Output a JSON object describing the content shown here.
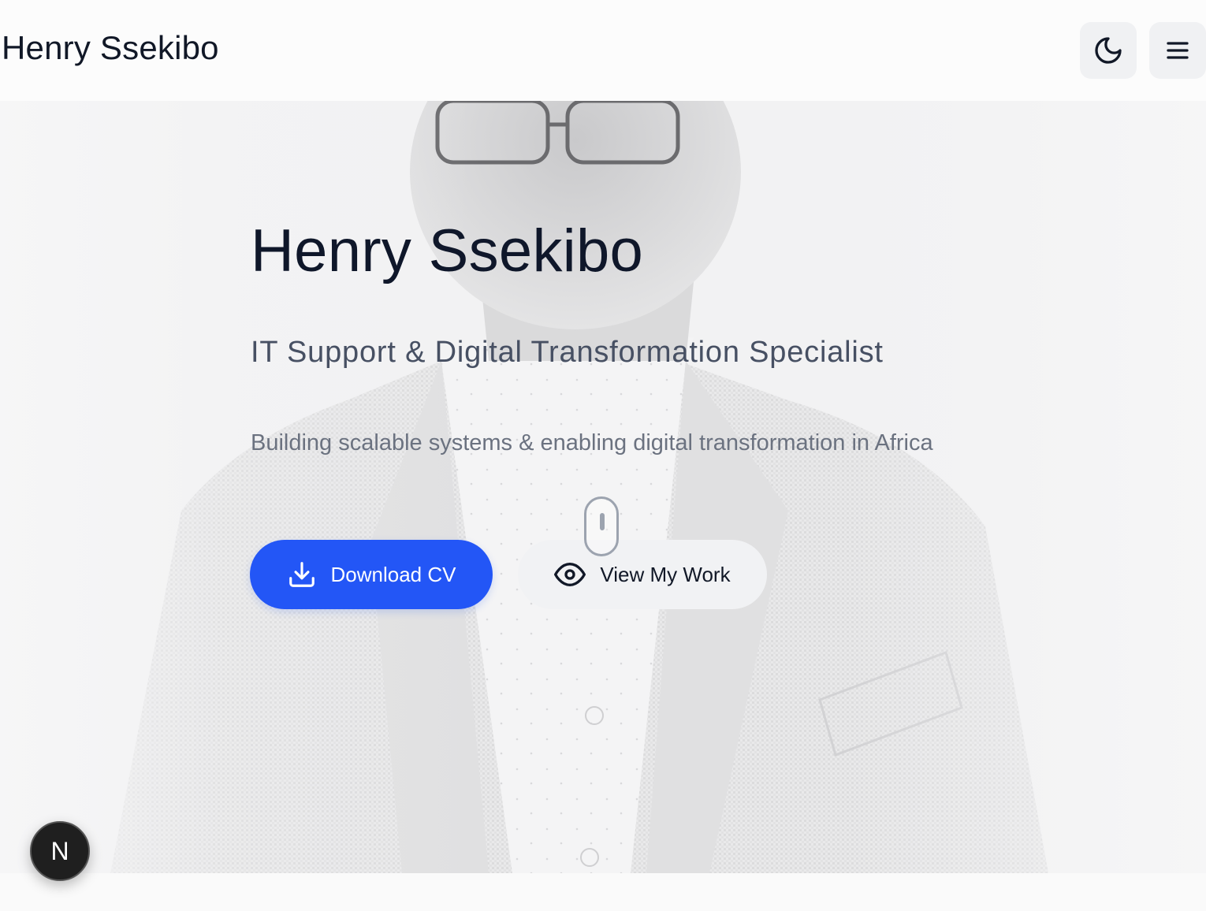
{
  "header": {
    "brand": "Henry Ssekibo",
    "theme_toggle_icon": "moon-icon",
    "menu_icon": "hamburger-menu-icon"
  },
  "hero": {
    "title": "Henry Ssekibo",
    "subtitle": "IT Support & Digital Transformation Specialist",
    "tagline": "Building scalable systems & enabling digital transformation in Africa",
    "primary_button": {
      "label": "Download CV",
      "icon": "download-icon"
    },
    "secondary_button": {
      "label": "View My Work",
      "icon": "eye-icon"
    },
    "scroll_indicator_icon": "mouse-scroll-icon",
    "background_image": "portrait-photo"
  },
  "badge": {
    "letter": "N",
    "icon": "nextjs-badge-icon"
  },
  "colors": {
    "primary": "#2356f6",
    "text_dark": "#0f172a",
    "text_muted": "#6b7280",
    "button_secondary_bg": "#f1f2f4"
  }
}
